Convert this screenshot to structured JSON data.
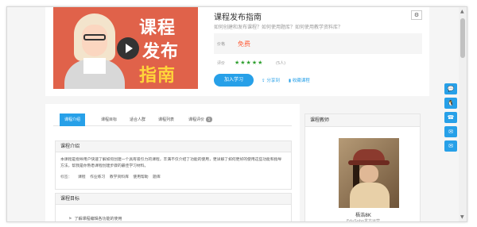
{
  "course": {
    "cover_lines": [
      "课程",
      "发布",
      "指南"
    ],
    "title": "课程发布指南",
    "subtitle": "如何创建和发布课程？如何使用题库？如何使用教学资料库？",
    "price_label": "价格",
    "price_value": "免费",
    "rating_label": "评价",
    "stars": "★★★★★",
    "rating_count": "(5人)",
    "join_label": "加入学习",
    "share_label": "分享到",
    "fav_label": "收藏课程",
    "gear_icon": "⚙"
  },
  "tabs": [
    {
      "label": "课程介绍"
    },
    {
      "label": "课程目标"
    },
    {
      "label": "适合人群"
    },
    {
      "label": "课程列表"
    },
    {
      "label": "课程评价",
      "count": "5"
    }
  ],
  "intro": {
    "heading": "课程介绍",
    "text": "本课程是指导用户快速了解如何创建一个具有吸引力的课程，丰满不仅介绍了功能的使用，更详解了如何更好的使用这些功能和指导方法，帮我是你熟悉课程创建步骤的最佳学习材料。",
    "tags_label": "标签：",
    "tags": [
      "课程",
      "作业练习",
      "教学资料库",
      "使用帮助",
      "题库"
    ]
  },
  "goals": {
    "heading": "课程目标",
    "item": "了解课程编辑各功能的使用"
  },
  "teacher": {
    "heading": "课程教师",
    "name": "梧浩8K",
    "role": "EduSoho发方运营"
  },
  "floatbar": [
    "💬",
    "🐧",
    "☎",
    "✉",
    "✉"
  ]
}
